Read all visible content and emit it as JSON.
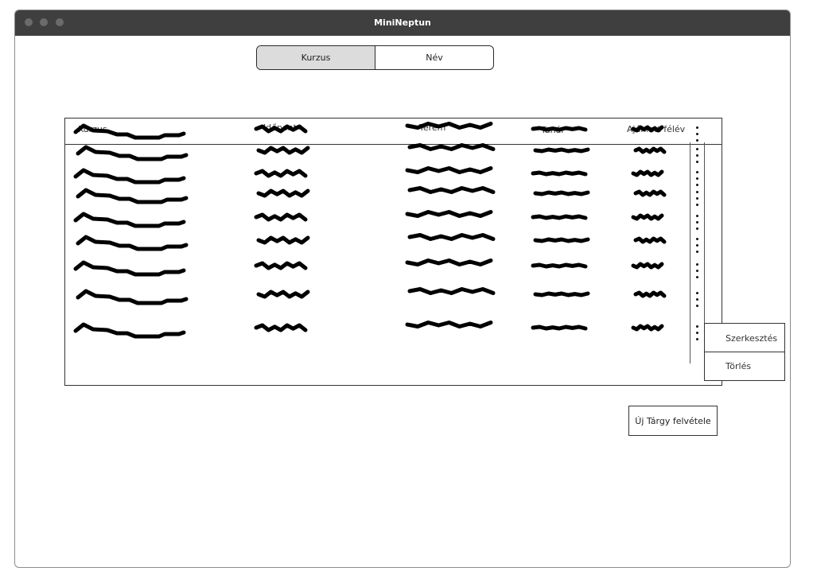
{
  "window": {
    "title": "MiniNeptun"
  },
  "toggle": {
    "options": [
      {
        "label": "Kurzus",
        "active": true
      },
      {
        "label": "Név",
        "active": false
      }
    ]
  },
  "table": {
    "headers": [
      "Kurzus",
      "Időpont",
      "Terem",
      "Tanár",
      "Ajánlott félév"
    ],
    "row_count": 9,
    "cell_content": "placeholder scribbles"
  },
  "context_menu": {
    "edit_label": "Szerkesztés",
    "delete_label": "Törlés"
  },
  "actions": {
    "new_subject_label": "Új Tárgy felvétele"
  },
  "colors": {
    "titlebar": "#3f3f3f",
    "active_toggle": "#dcdcdc",
    "scribble": "#000000"
  }
}
